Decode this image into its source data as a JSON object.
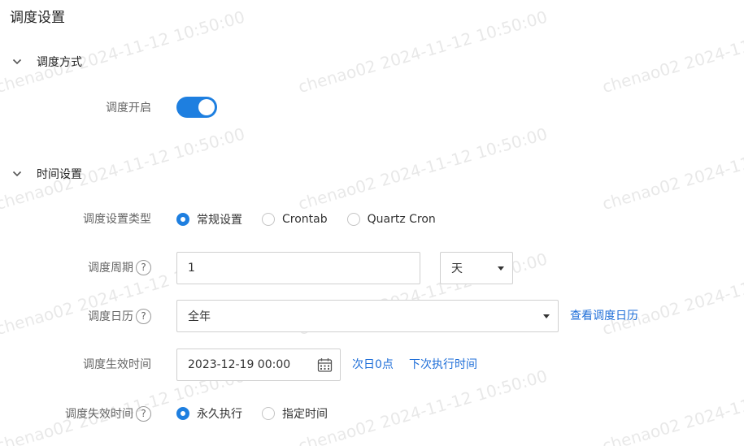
{
  "page": {
    "title": "调度设置"
  },
  "sections": {
    "mode": {
      "title": "调度方式"
    },
    "time": {
      "title": "时间设置"
    }
  },
  "schedule_enable": {
    "label": "调度开启",
    "on": true
  },
  "schedule_type": {
    "label": "调度设置类型",
    "options": [
      "常规设置",
      "Crontab",
      "Quartz Cron"
    ],
    "selected": "常规设置"
  },
  "period": {
    "label": "调度周期",
    "help": "?",
    "value": "1",
    "unit": "天"
  },
  "calendar": {
    "label": "调度日历",
    "help": "?",
    "value": "全年",
    "link": "查看调度日历"
  },
  "effective_time": {
    "label": "调度生效时间",
    "value": "2023-12-19 00:00",
    "links": [
      "次日0点",
      "下次执行时间"
    ]
  },
  "expire_time": {
    "label": "调度失效时间",
    "help": "?",
    "options": [
      "永久执行",
      "指定时间"
    ],
    "selected": "永久执行"
  },
  "watermark": {
    "text": "chenao02 2024-11-12 10:50:00"
  },
  "colors": {
    "accent": "#1e7fe0",
    "link": "#1e6ed8"
  }
}
